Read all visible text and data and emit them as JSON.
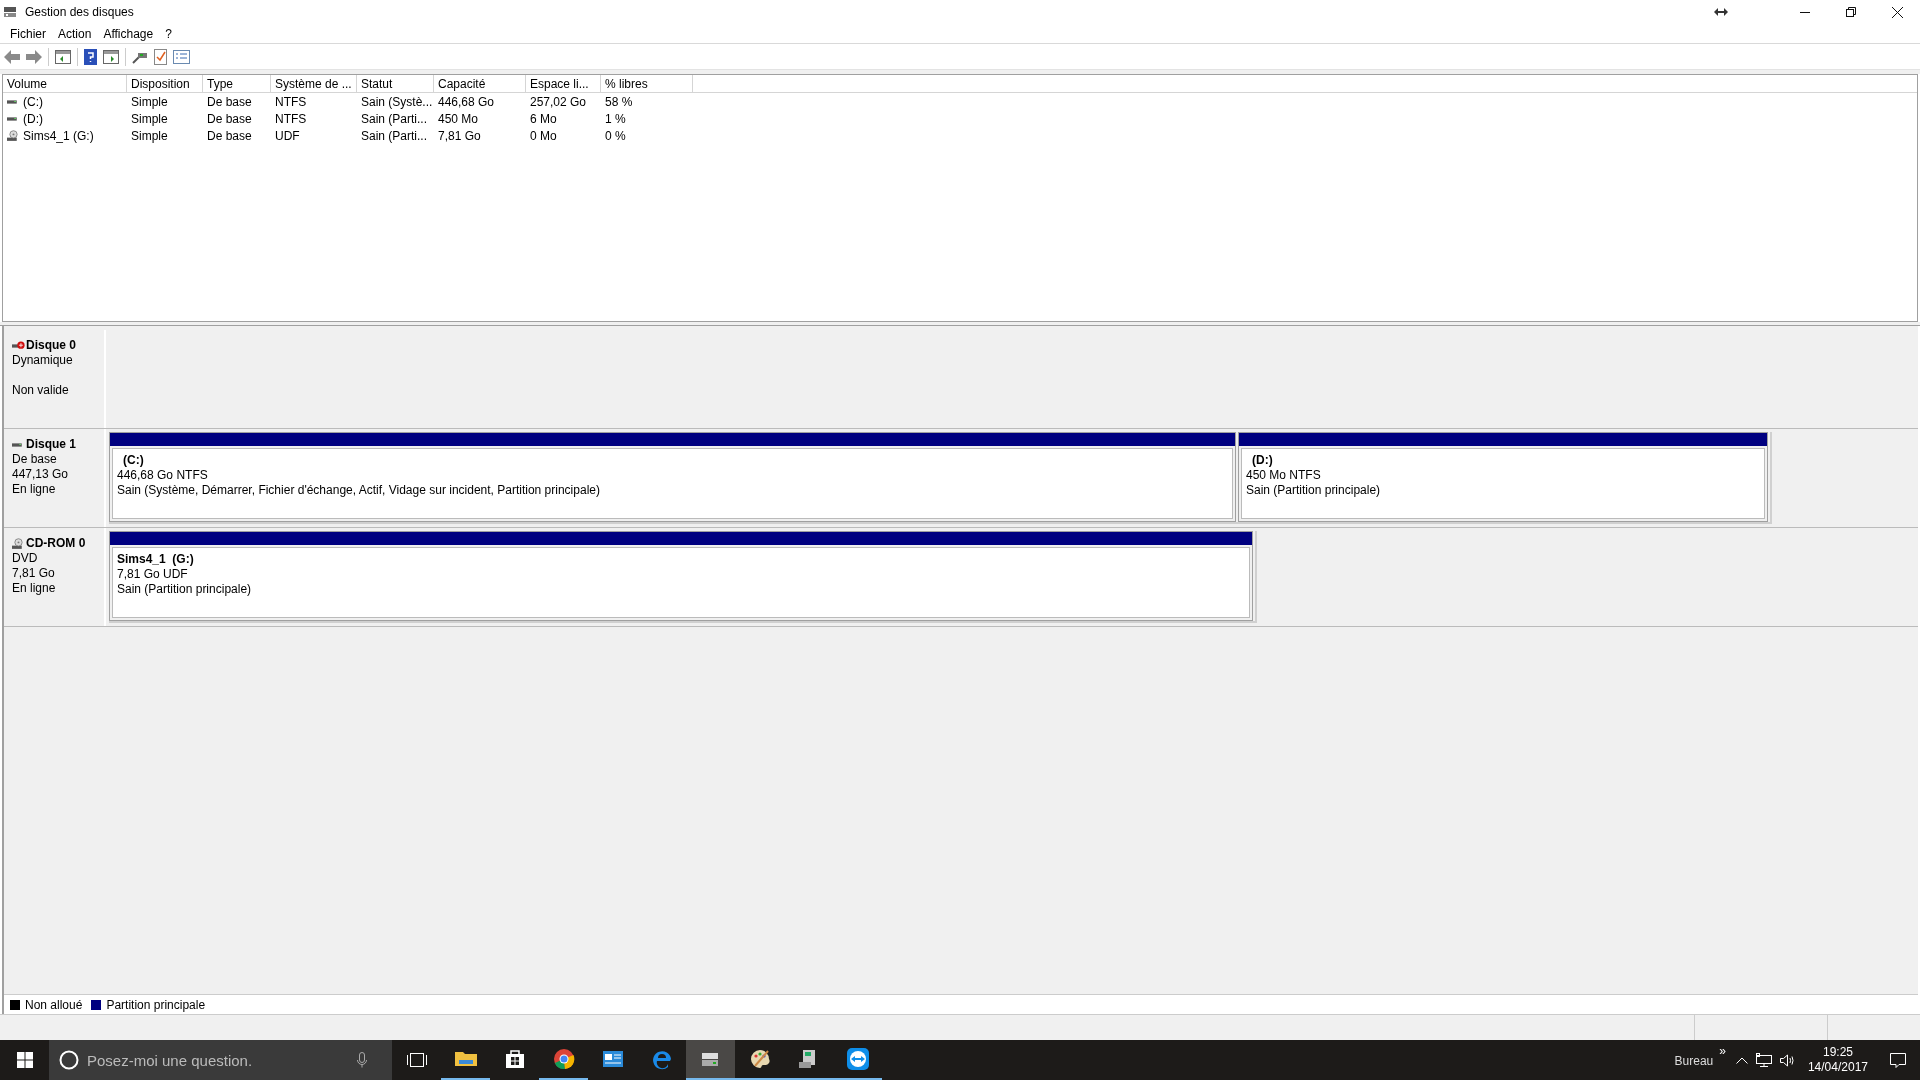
{
  "window": {
    "title": "Gestion des disques"
  },
  "menu": [
    "Fichier",
    "Action",
    "Affichage",
    "?"
  ],
  "table": {
    "columns": [
      "Volume",
      "Disposition",
      "Type",
      "Système de ...",
      "Statut",
      "Capacité",
      "Espace li...",
      "% libres"
    ],
    "rows": [
      {
        "kind": "hdd",
        "cells": [
          "(C:)",
          "Simple",
          "De base",
          "NTFS",
          "Sain (Systè...",
          "446,68 Go",
          "257,02 Go",
          "58 %"
        ]
      },
      {
        "kind": "hdd",
        "cells": [
          "(D:)",
          "Simple",
          "De base",
          "NTFS",
          "Sain (Parti...",
          "450 Mo",
          "6 Mo",
          "1 %"
        ]
      },
      {
        "kind": "cdrom",
        "cells": [
          "Sims4_1 (G:)",
          "Simple",
          "De base",
          "UDF",
          "Sain (Parti...",
          "7,81 Go",
          "0 Mo",
          "0 %"
        ]
      }
    ]
  },
  "disks": [
    {
      "kind": "hdd",
      "error": true,
      "name": "Disque 0",
      "type": "Dynamique",
      "state": "Non valide"
    },
    {
      "kind": "hdd",
      "error": false,
      "name": "Disque 1",
      "type": "De base",
      "size": "447,13 Go",
      "state": "En ligne",
      "partitions": [
        {
          "name": "(C:)",
          "size": "446,68 Go NTFS",
          "status": "Sain (Système, Démarrer, Fichier d'échange, Actif, Vidage sur incident, Partition principale)",
          "color": "#000080"
        },
        {
          "name": "(D:)",
          "size": "450 Mo NTFS",
          "status": "Sain (Partition principale)",
          "color": "#000080"
        }
      ]
    },
    {
      "kind": "cdrom",
      "error": false,
      "name": "CD-ROM 0",
      "type": "DVD",
      "size": "7,81 Go",
      "state": "En ligne",
      "partitions": [
        {
          "name": "Sims4_1  (G:)",
          "size": "7,81 Go UDF",
          "status": "Sain (Partition principale)",
          "color": "#000080"
        }
      ]
    }
  ],
  "legend": [
    {
      "label": "Non alloué",
      "color": "#000000"
    },
    {
      "label": "Partition principale",
      "color": "#000080"
    }
  ],
  "taskbar": {
    "search": {
      "placeholder": "Posez-moi une question."
    },
    "apps": [
      {
        "kind": "explorer",
        "running": true,
        "active": false
      },
      {
        "kind": "store",
        "running": false,
        "active": false
      },
      {
        "kind": "chrome",
        "running": true,
        "active": false
      },
      {
        "kind": "panel",
        "running": false,
        "active": false
      },
      {
        "kind": "edge",
        "running": false,
        "active": false
      },
      {
        "kind": "disk",
        "running": true,
        "active": true
      },
      {
        "kind": "paint",
        "running": true,
        "active": false
      },
      {
        "kind": "computer",
        "running": true,
        "active": false
      },
      {
        "kind": "teamviewer",
        "running": true,
        "active": false
      }
    ],
    "toolbar_label": "Bureau",
    "overflow": "»",
    "time": "19:25",
    "date": "14/04/2017"
  }
}
